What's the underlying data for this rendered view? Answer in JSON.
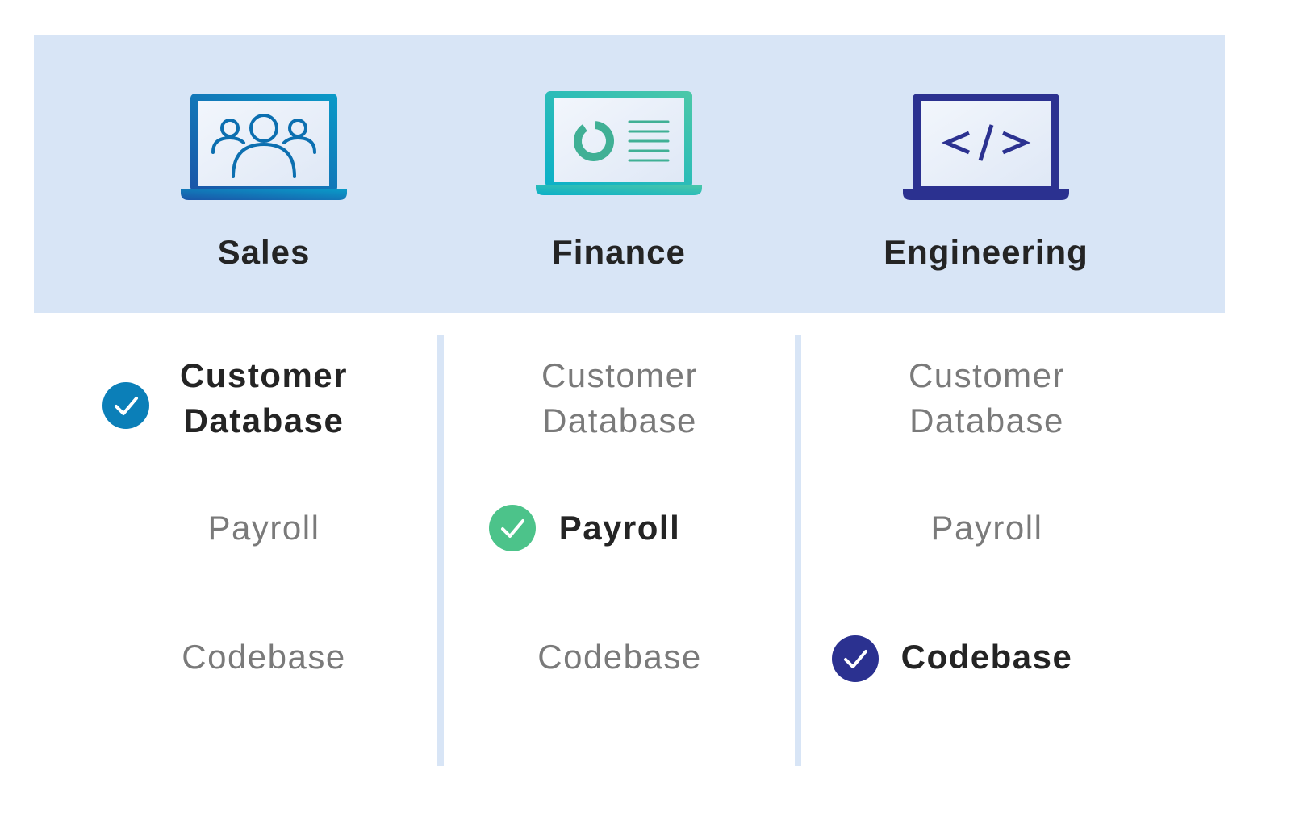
{
  "colors": {
    "header_bg": "#d8e5f6",
    "sales": "#0b7fb8",
    "finance": "#4cc38a",
    "engineering": "#2b3190",
    "active_text": "#242424",
    "inactive_text": "#7a7a7a"
  },
  "departments": [
    {
      "name": "Sales",
      "icon": "laptop-people-icon"
    },
    {
      "name": "Finance",
      "icon": "laptop-report-icon"
    },
    {
      "name": "Engineering",
      "icon": "laptop-code-icon"
    }
  ],
  "resources": [
    "Customer Database",
    "Payroll",
    "Codebase"
  ],
  "access": {
    "sales": {
      "customer_database": {
        "label": "Customer Database",
        "line1": "Customer",
        "line2": "Database",
        "granted": true
      },
      "payroll": {
        "label": "Payroll",
        "granted": false
      },
      "codebase": {
        "label": "Codebase",
        "granted": false
      }
    },
    "finance": {
      "customer_database": {
        "label": "Customer Database",
        "line1": "Customer",
        "line2": "Database",
        "granted": false
      },
      "payroll": {
        "label": "Payroll",
        "granted": true
      },
      "codebase": {
        "label": "Codebase",
        "granted": false
      }
    },
    "engineering": {
      "customer_database": {
        "label": "Customer Database",
        "line1": "Customer",
        "line2": "Database",
        "granted": false
      },
      "payroll": {
        "label": "Payroll",
        "granted": false
      },
      "codebase": {
        "label": "Codebase",
        "granted": true
      }
    }
  }
}
